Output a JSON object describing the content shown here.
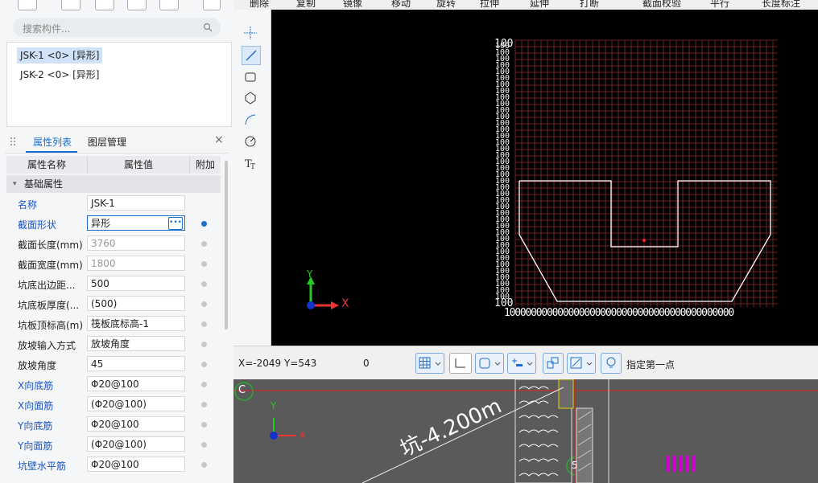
{
  "search": {
    "placeholder": "搜索构件..."
  },
  "components": [
    {
      "label": "JSK-1 <0> [异形]",
      "selected": true
    },
    {
      "label": "JSK-2 <0> [异形]",
      "selected": false
    }
  ],
  "panel": {
    "tabs": [
      "属性列表",
      "图层管理"
    ],
    "close": "×",
    "headers": {
      "name": "属性名称",
      "value": "属性值",
      "extra": "附加"
    },
    "group": "基础属性",
    "rows": [
      {
        "name": "名称",
        "value": "JSK-1",
        "blue": true
      },
      {
        "name": "截面形状",
        "value": "异形",
        "blue": true
      },
      {
        "name": "截面长度(mm)",
        "value": "3760"
      },
      {
        "name": "截面宽度(mm)",
        "value": "1800"
      },
      {
        "name": "坑底出边距...",
        "value": "500"
      },
      {
        "name": "坑底板厚度(...",
        "value": "(500)"
      },
      {
        "name": "坑板顶标高(m)",
        "value": "筏板底标高-1"
      },
      {
        "name": "放坡输入方式",
        "value": "放坡角度"
      },
      {
        "name": "放坡角度",
        "value": "45"
      },
      {
        "name": "X向底筋",
        "value": "Φ20@100",
        "blue": true
      },
      {
        "name": "X向面筋",
        "value": "(Φ20@100)",
        "blue": true
      },
      {
        "name": "Y向底筋",
        "value": "Φ20@100",
        "blue": true
      },
      {
        "name": "Y向面筋",
        "value": "(Φ20@100)",
        "blue": true
      },
      {
        "name": "坑壁水平筋",
        "value": "Φ20@100",
        "blue": true
      }
    ]
  },
  "toolbar": {
    "items": [
      "删除",
      "复制",
      "镜像",
      "移动",
      "旋转",
      "拉伸",
      "延伸",
      "打断",
      "截面校验",
      "平行",
      "长度标注"
    ]
  },
  "canvas": {
    "grid_label_left": "100",
    "grid_label_bottom": "100",
    "bottom_digits": "1000000000000000000000000000000000000000000",
    "axis_x": "X",
    "axis_y": "Y"
  },
  "status": {
    "coords": "X=-2049 Y=543",
    "value": "0",
    "prompt": "指定第一点"
  },
  "view2": {
    "label_c": "C",
    "label_5": "5",
    "dim_text": "坑-4.200m",
    "axis_x": "x",
    "axis_y": "Y"
  },
  "colors": {
    "grid": "#8b2a2a",
    "accent": "#1a6fd0",
    "outline": "#ffffff"
  }
}
